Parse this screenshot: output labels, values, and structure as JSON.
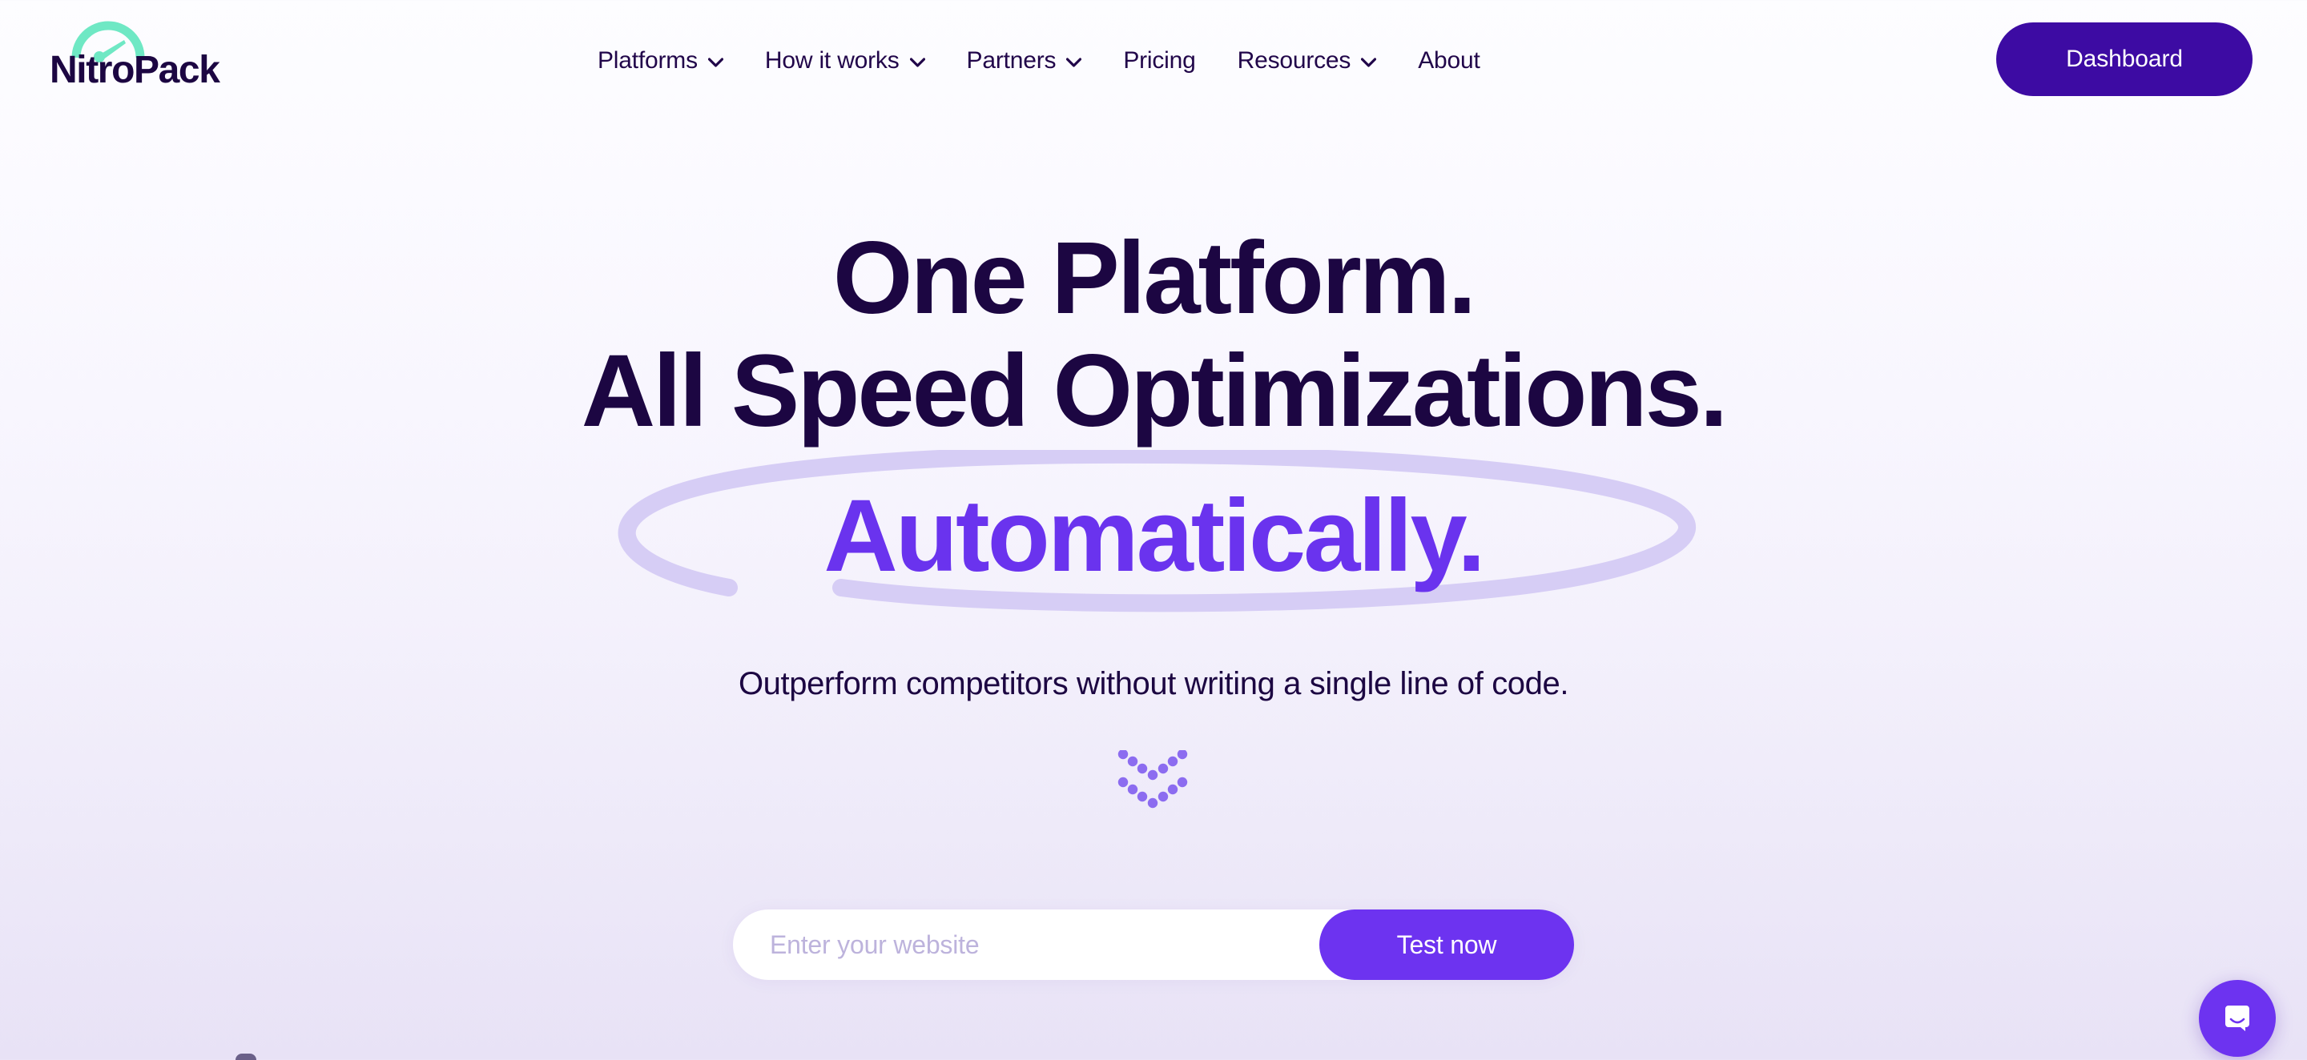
{
  "brand": {
    "name": "NitroPack",
    "logo_icon": "speedometer-icon",
    "logo_arc_color": "#6fe8c4",
    "wordmark_color": "#1c0642"
  },
  "header": {
    "nav": [
      {
        "label": "Platforms",
        "has_dropdown": true,
        "icon": "chevron-down-icon"
      },
      {
        "label": "How it works",
        "has_dropdown": true,
        "icon": "chevron-down-icon"
      },
      {
        "label": "Partners",
        "has_dropdown": true,
        "icon": "chevron-down-icon"
      },
      {
        "label": "Pricing",
        "has_dropdown": false,
        "icon": ""
      },
      {
        "label": "Resources",
        "has_dropdown": true,
        "icon": "chevron-down-icon"
      },
      {
        "label": "About",
        "has_dropdown": false,
        "icon": ""
      }
    ],
    "dashboard_button": {
      "label": "Dashboard",
      "bg_color": "#3d0ba3",
      "text_color": "#ffffff"
    }
  },
  "hero": {
    "headline_line1": "One Platform.",
    "headline_line2": "All Speed Optimizations.",
    "headline_highlight": "Automatically.",
    "headline_color": "#1c0642",
    "highlight_color": "#6a33ee",
    "circle_annotation_color": "#d6cdf5",
    "subtitle": "Outperform competitors without writing a single line of code.",
    "scroll_hint_icon": "double-chevron-down-dots-icon",
    "scroll_hint_color": "#8c6cf0"
  },
  "search": {
    "placeholder": "Enter your website",
    "value": "",
    "button_label": "Test now",
    "button_color": "#6d33f0",
    "field_bg": "#ffffff",
    "placeholder_color": "#bdb3dc"
  },
  "chat": {
    "icon": "chat-bubble-smile-icon",
    "bg_color": "#6d33f0",
    "icon_color": "#ffffff"
  },
  "page": {
    "background_top": "#fdfdff",
    "background_bottom": "#e8e2f6"
  }
}
